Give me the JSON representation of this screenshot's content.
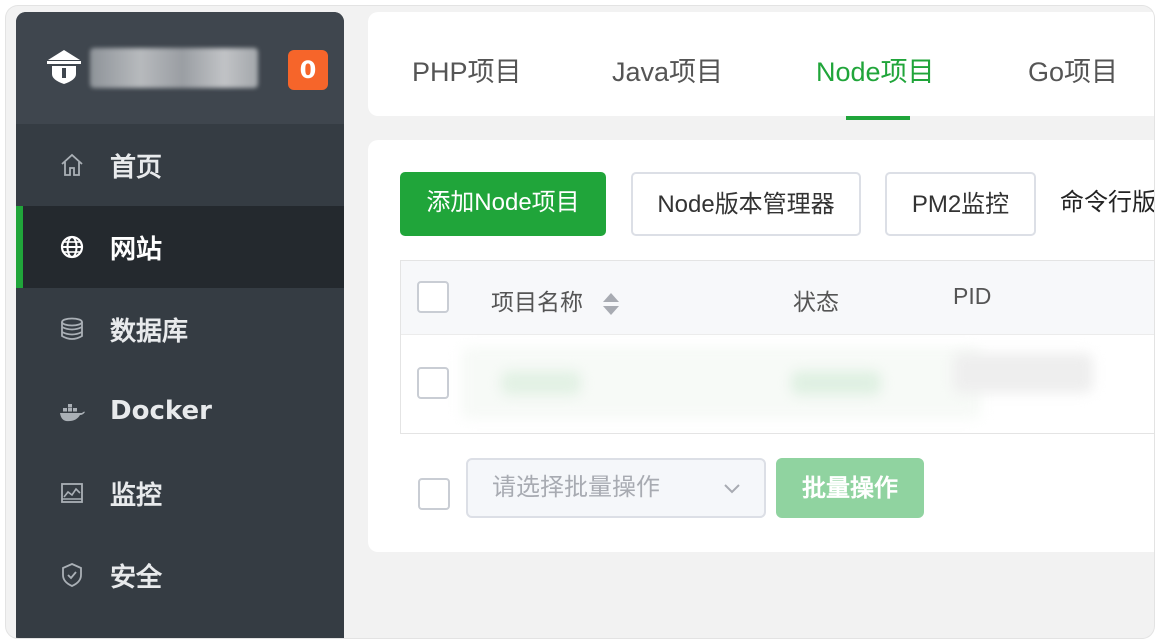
{
  "sidebar": {
    "badge": "0",
    "items": [
      {
        "label": "首页",
        "icon": "home-icon"
      },
      {
        "label": "网站",
        "icon": "globe-icon",
        "active": true
      },
      {
        "label": "数据库",
        "icon": "database-icon"
      },
      {
        "label": "Docker",
        "icon": "docker-icon"
      },
      {
        "label": "监控",
        "icon": "monitor-icon"
      },
      {
        "label": "安全",
        "icon": "shield-icon"
      }
    ]
  },
  "tabs": [
    {
      "label": "PHP项目"
    },
    {
      "label": "Java项目"
    },
    {
      "label": "Node项目",
      "active": true
    },
    {
      "label": "Go项目"
    }
  ],
  "toolbar": {
    "add_label": "添加Node项目",
    "version_label": "Node版本管理器",
    "pm2_label": "PM2监控",
    "cli_label": "命令行版"
  },
  "table": {
    "columns": [
      "项目名称",
      "状态",
      "PID"
    ]
  },
  "batch": {
    "placeholder": "请选择批量操作",
    "button_label": "批量操作"
  },
  "colors": {
    "accent": "#20a53a",
    "sidebar_bg": "#353c43",
    "badge": "#f6652a"
  }
}
